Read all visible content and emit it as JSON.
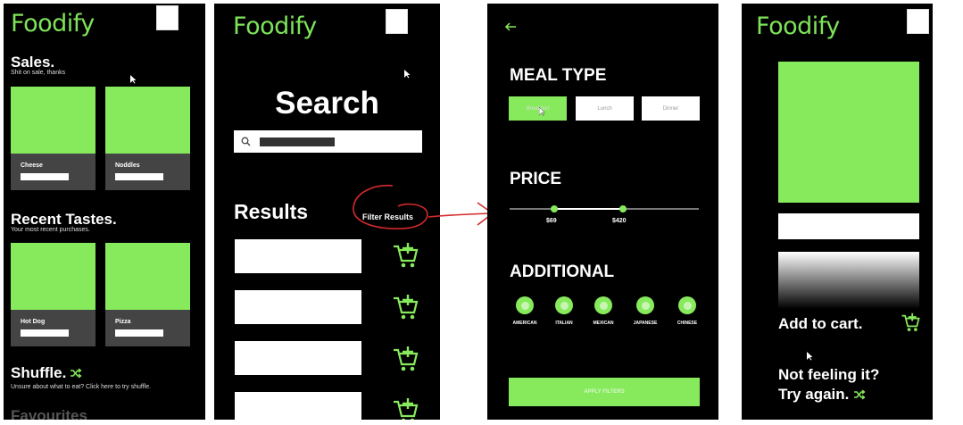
{
  "colors": {
    "accent": "#86ea5c",
    "brand": "#7ee35a",
    "annotation": "#d42a2a"
  },
  "p1": {
    "brand": "Foodify",
    "sales_title": "Sales.",
    "sales_sub": "Shit on sale, thanks",
    "sales_cards": [
      {
        "label": "Cheese"
      },
      {
        "label": "Noddles"
      }
    ],
    "recent_title": "Recent Tastes.",
    "recent_sub": "Your most recent purchases.",
    "recent_cards": [
      {
        "label": "Hot Dog"
      },
      {
        "label": "Pizza"
      }
    ],
    "shuffle_title": "Shuffle.",
    "shuffle_sub": "Unsure about what to eat? Click here to try shuffle.",
    "favourites_title": "Favourites"
  },
  "p2": {
    "brand": "Foodify",
    "search_title": "Search",
    "results_title": "Results",
    "filter_label": "Filter Results",
    "results_count": 4
  },
  "p3": {
    "back_icon": "arrow-left-icon",
    "meal_type_title": "MEAL TYPE",
    "meal_types": [
      "Breakfast",
      "Lunch",
      "Dinner"
    ],
    "meal_selected": "Breakfast",
    "price_title": "PRICE",
    "price_min": "$69",
    "price_max": "$420",
    "additional_title": "ADDITIONAL",
    "cuisines": [
      "AMERICAN",
      "ITALIAN",
      "MEXICAN",
      "JAPANESE",
      "CHINESE"
    ],
    "apply_label": "APPLY FILTERS"
  },
  "p4": {
    "brand": "Foodify",
    "add_to_cart": "Add to cart.",
    "not_feeling_line1": "Not feeling it?",
    "not_feeling_line2": "Try again."
  }
}
